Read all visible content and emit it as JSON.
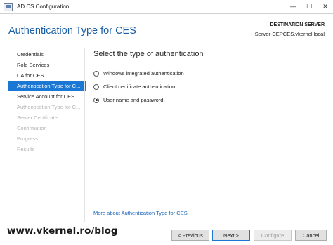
{
  "window": {
    "title": "AD CS Configuration",
    "controls": {
      "minimize": "—",
      "maximize": "☐",
      "close": "✕"
    }
  },
  "header": {
    "title": "Authentication Type for CES",
    "destination_label": "DESTINATION SERVER",
    "destination_value": "Server-CEPCES.vkernel.local"
  },
  "sidebar": {
    "items": [
      {
        "label": "Credentials",
        "state": "normal"
      },
      {
        "label": "Role Services",
        "state": "normal"
      },
      {
        "label": "CA for CES",
        "state": "normal"
      },
      {
        "label": "Authentication Type for C...",
        "state": "active"
      },
      {
        "label": "Service Account for CES",
        "state": "normal"
      },
      {
        "label": "Authentication Type for C...",
        "state": "disabled"
      },
      {
        "label": "Server Certificate",
        "state": "disabled"
      },
      {
        "label": "Confirmation",
        "state": "disabled"
      },
      {
        "label": "Progress",
        "state": "disabled"
      },
      {
        "label": "Results",
        "state": "disabled"
      }
    ]
  },
  "main": {
    "heading": "Select the type of authentication",
    "options": [
      {
        "label": "Windows integrated authentication",
        "checked": false
      },
      {
        "label": "Client certificate authentication",
        "checked": false
      },
      {
        "label": "User name and password",
        "checked": true
      }
    ],
    "more_link": "More about Authentication Type for CES"
  },
  "footer": {
    "watermark": "www.vkernel.ro/blog",
    "previous": "< Previous",
    "next": "Next >",
    "configure": "Configure",
    "cancel": "Cancel"
  },
  "colors": {
    "accent": "#1a78d4",
    "header_title": "#1b5fa8",
    "link": "#1b64b8",
    "disabled_text": "#b4b4b4"
  }
}
